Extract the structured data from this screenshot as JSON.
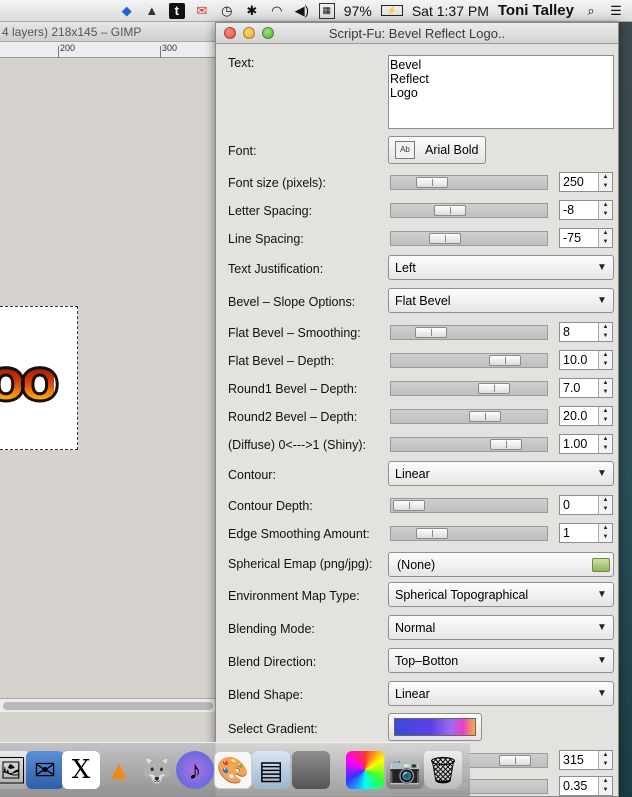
{
  "menubar": {
    "battery": "97%",
    "clock": "Sat 1:37 PM",
    "user": "Toni Talley",
    "icons": [
      "dropbox-icon",
      "google-drive-icon",
      "tumblr-icon",
      "mail-icon",
      "time-machine-icon",
      "bluetooth-icon",
      "wifi-icon",
      "volume-icon",
      "keyboard-flag-icon",
      "battery-icon",
      "spotlight-icon",
      "notification-center-icon"
    ]
  },
  "gimp_window": {
    "title": "4 layers) 218x145 – GIMP",
    "ruler": [
      "200",
      "300"
    ],
    "canvas_text": "oo"
  },
  "dialog": {
    "title": "Script-Fu: Bevel Reflect Logo..",
    "text_label": "Text:",
    "text_value": "Bevel\nReflect\nLogo",
    "font_label": "Font:",
    "font_value": "Arial Bold",
    "font_icon_text": "Ab",
    "sliders": [
      {
        "label": "Font size (pixels):",
        "value": "250",
        "pos": 0.2
      },
      {
        "label": "Letter Spacing:",
        "value": "-8",
        "pos": 0.35
      },
      {
        "label": "Line Spacing:",
        "value": "-75",
        "pos": 0.31
      }
    ],
    "text_justification": {
      "label": "Text Justification:",
      "value": "Left"
    },
    "bevel_slope": {
      "label": "Bevel – Slope Options:",
      "value": "Flat Bevel"
    },
    "sliders2": [
      {
        "label": "Flat Bevel – Smoothing:",
        "value": "8",
        "pos": 0.19
      },
      {
        "label": "Flat Bevel – Depth:",
        "value": "10.0",
        "pos": 0.79
      },
      {
        "label": "Round1 Bevel – Depth:",
        "value": "7.0",
        "pos": 0.7
      },
      {
        "label": "Round2 Bevel – Depth:",
        "value": "20.0",
        "pos": 0.63
      },
      {
        "label": "(Diffuse) 0<--->1 (Shiny):",
        "value": "1.00",
        "pos": 0.8
      }
    ],
    "contour": {
      "label": "Contour:",
      "value": "Linear"
    },
    "sliders3": [
      {
        "label": "Contour Depth:",
        "value": "0",
        "pos": 0.02
      },
      {
        "label": "Edge Smoothing Amount:",
        "value": "1",
        "pos": 0.2
      }
    ],
    "emap": {
      "label": "Spherical Emap (png/jpg):",
      "value": "(None)"
    },
    "env_map_type": {
      "label": "Environment Map Type:",
      "value": "Spherical Topographical"
    },
    "blending_mode": {
      "label": "Blending Mode:",
      "value": "Normal"
    },
    "blend_direction": {
      "label": "Blend Direction:",
      "value": "Top–Botton"
    },
    "blend_shape": {
      "label": "Blend Shape:",
      "value": "Linear"
    },
    "select_gradient": {
      "label": "Select Gradient:"
    },
    "partial_rows": [
      {
        "label": "t Direction (Degre",
        "value": "315"
      },
      {
        "label": "",
        "value": "0.35"
      }
    ]
  },
  "dock": {
    "apps": [
      "preview",
      "mail",
      "x11",
      "vlc",
      "gimp-wilber",
      "itunes",
      "gimp-active",
      "preview-doc",
      "terminal",
      "colorpicker",
      "image-capture",
      "trash"
    ]
  }
}
